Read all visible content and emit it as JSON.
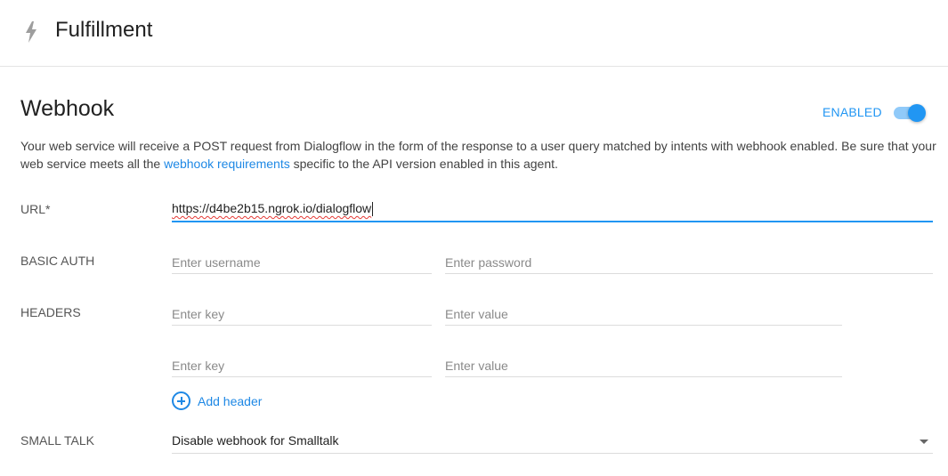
{
  "header": {
    "icon": "lightning-bolt-icon",
    "title": "Fulfillment"
  },
  "webhook": {
    "title": "Webhook",
    "enabled_label": "ENABLED",
    "enabled": true,
    "description_before": "Your web service will receive a POST request from Dialogflow in the form of the response to a user query matched by intents with webhook enabled. Be sure that your web service meets all the ",
    "description_link": "webhook requirements",
    "description_after": " specific to the API version enabled in this agent."
  },
  "form": {
    "url_label": "URL*",
    "url_value": "https://d4be2b15.ngrok.io/dialogflow",
    "basic_auth_label": "BASIC AUTH",
    "username_placeholder": "Enter username",
    "password_placeholder": "Enter password",
    "headers_label": "HEADERS",
    "headers": [
      {
        "key_placeholder": "Enter key",
        "value_placeholder": "Enter value"
      },
      {
        "key_placeholder": "Enter key",
        "value_placeholder": "Enter value"
      }
    ],
    "add_header_label": "Add header",
    "small_talk_label": "SMALL TALK",
    "small_talk_value": "Disable webhook for Smalltalk"
  },
  "colors": {
    "accent": "#2196f3",
    "link": "#1e88e5",
    "toggle_track": "#90caf9"
  }
}
